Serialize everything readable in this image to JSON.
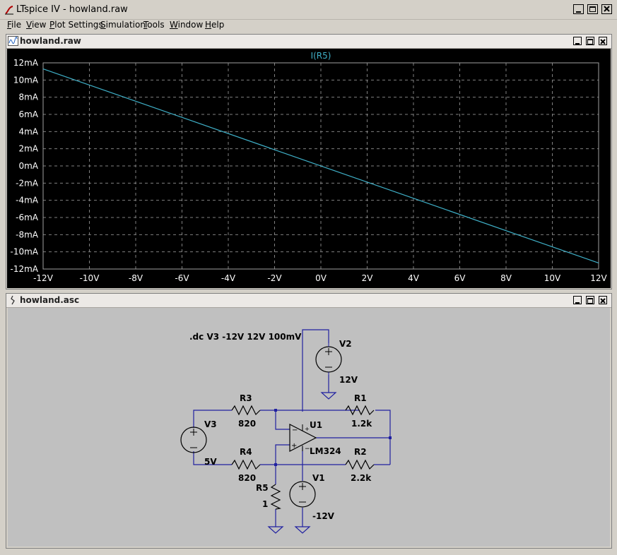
{
  "app": {
    "title": "LTspice IV - howland.raw"
  },
  "menu": [
    {
      "label": "File",
      "ul": "F",
      "rest": "ile"
    },
    {
      "label": "View",
      "ul": "V",
      "rest": "iew"
    },
    {
      "label": "Plot Settings",
      "ul": "P",
      "rest": "lot Settings"
    },
    {
      "label": "Simulation",
      "ul": "S",
      "rest": "imulation"
    },
    {
      "label": "Tools",
      "ul": "T",
      "rest": "ools"
    },
    {
      "label": "Window",
      "ul": "W",
      "rest": "indow"
    },
    {
      "label": "Help",
      "ul": "H",
      "rest": "elp"
    }
  ],
  "waveform_window": {
    "title": "howland.raw",
    "trace_label": "I(R5)",
    "trace_color": "#3fb0c8",
    "background": "#000000"
  },
  "chart_data": {
    "type": "line",
    "title": "I(R5)",
    "x_unit": "V",
    "y_unit": "mA",
    "xlim": [
      -12,
      12
    ],
    "ylim": [
      -12,
      12
    ],
    "x_ticks": [
      "-12V",
      "-10V",
      "-8V",
      "-6V",
      "-4V",
      "-2V",
      "0V",
      "2V",
      "4V",
      "6V",
      "8V",
      "10V",
      "12V"
    ],
    "y_ticks": [
      "12mA",
      "10mA",
      "8mA",
      "6mA",
      "4mA",
      "2mA",
      "0mA",
      "-2mA",
      "-4mA",
      "-6mA",
      "-8mA",
      "-10mA",
      "-12mA"
    ],
    "grid": true,
    "series": [
      {
        "name": "I(R5)",
        "x": [
          -12,
          12
        ],
        "y": [
          11.3,
          -11.3
        ]
      }
    ]
  },
  "schematic_window": {
    "title": "howland.asc",
    "directive": ".dc V3 -12V 12V 100mV",
    "components": {
      "V2": {
        "name": "V2",
        "value": "12V"
      },
      "V3": {
        "name": "V3",
        "value": "5V"
      },
      "V1": {
        "name": "V1",
        "value": "-12V"
      },
      "R3": {
        "name": "R3",
        "value": "820"
      },
      "R4": {
        "name": "R4",
        "value": "820"
      },
      "R1": {
        "name": "R1",
        "value": "1.2k"
      },
      "R2": {
        "name": "R2",
        "value": "2.2k"
      },
      "R5": {
        "name": "R5",
        "value": "1"
      },
      "U1": {
        "name": "U1",
        "value": "LM324"
      }
    },
    "wire_color": "#2020a0"
  }
}
